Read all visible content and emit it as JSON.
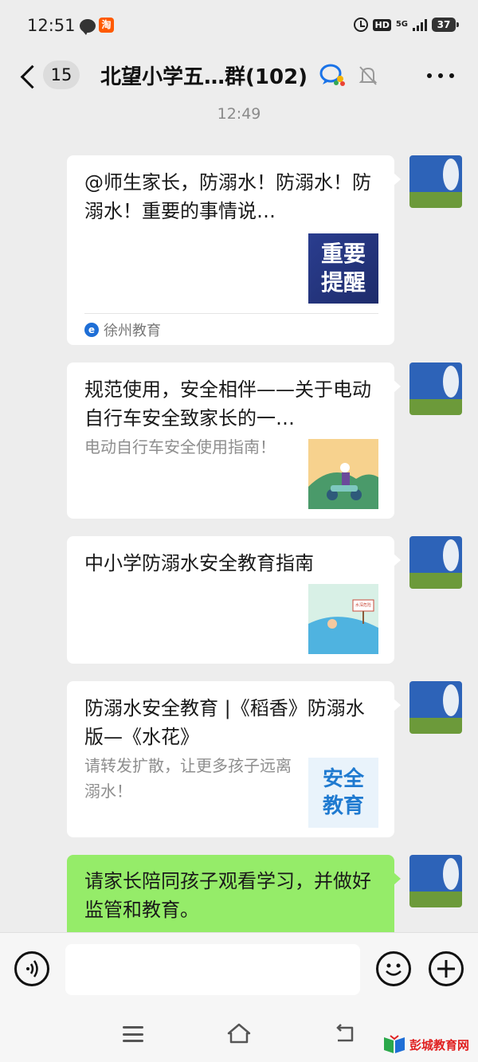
{
  "status_bar": {
    "time": "12:51",
    "taobao_glyph": "淘",
    "hd": "HD",
    "network": "5G",
    "battery": "37"
  },
  "nav": {
    "unread_count": "15",
    "title": "北望小学五…群(102)"
  },
  "timestamp": "12:49",
  "messages": [
    {
      "title": "@师生家长，防溺水！防溺水！防溺水！重要的事情说…",
      "thumb_text_1": "重要",
      "thumb_text_2": "提醒",
      "source_logo": "e",
      "source": "徐州教育"
    },
    {
      "title": "规范使用，安全相伴——关于电动自行车安全致家长的一…",
      "desc": "电动自行车安全使用指南！"
    },
    {
      "title": "中小学防溺水安全教育指南",
      "sign_text": "水深危险"
    },
    {
      "title": "防溺水安全教育 |《稻香》防溺水版—《水花》",
      "desc": "请转发扩散，让更多孩子远离溺水！",
      "thumb_text_1": "安全",
      "thumb_text_2": "教育"
    },
    {
      "text": "请家长陪同孩子观看学习，并做好监管和教育。"
    }
  ],
  "input": {
    "value": ""
  },
  "watermark": "彭城教育网",
  "colors": {
    "background": "#ededed",
    "sent_bubble": "#95ec69",
    "card_bubble": "#ffffff",
    "secondary_text": "#8e8e8e"
  }
}
